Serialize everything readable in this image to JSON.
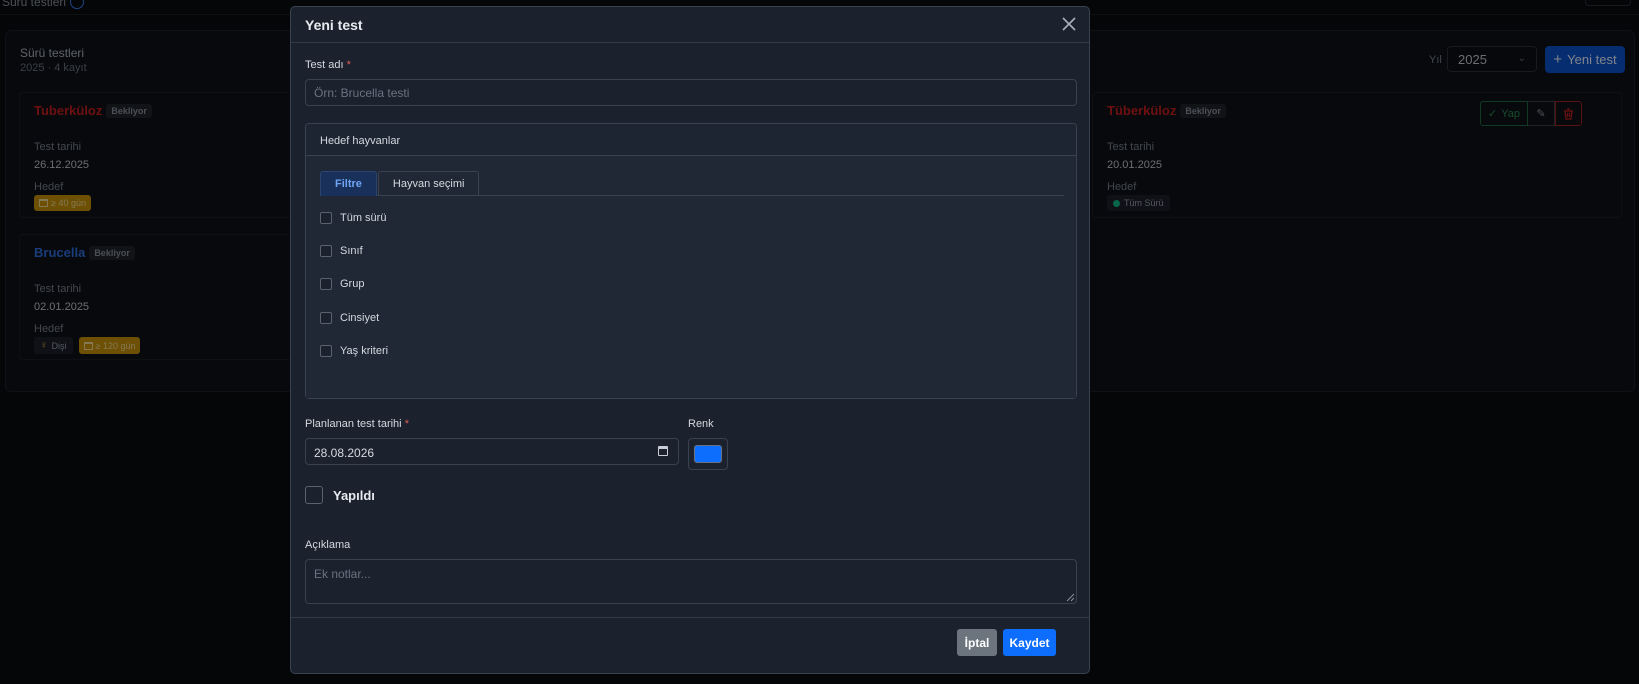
{
  "topbar": {
    "crumb": "Sürü testleri"
  },
  "panel": {
    "title": "Sürü testleri",
    "subtitle": "2025 · 4 kayıt",
    "year_label": "Yıl",
    "year_value": "2025",
    "new_button": "Yeni test"
  },
  "cards": [
    {
      "name": "Tuberküloz",
      "name_color": "#c81e1e",
      "status": "Bekliyor",
      "date_label": "Test tarihi",
      "date": "26.12.2025",
      "target_label": "Hedef",
      "tags": [
        "≥ 40 gün"
      ]
    },
    {
      "name": "Brucella",
      "name_color": "#2f6fe0",
      "status": "Bekliyor",
      "date_label": "Test tarihi",
      "date": "02.01.2025",
      "target_label": "Hedef",
      "tags": [
        "Dişi",
        "≥ 120 gün"
      ]
    },
    {
      "name": "Tüberküloz",
      "name_color": "#c81e1e",
      "status": "Bekliyor",
      "date_label": "Test tarihi",
      "date": "20.01.2025",
      "target_label": "Hedef",
      "tags": [
        "Tüm Sürü"
      ],
      "actions": {
        "yap": "Yap"
      }
    }
  ],
  "modal": {
    "title": "Yeni test",
    "test_name_label": "Test adı",
    "test_name_placeholder": "Örn: Brucella testi",
    "target_title": "Hedef hayvanlar",
    "tabs": [
      "Filtre",
      "Hayvan seçimi"
    ],
    "filters": [
      "Tüm sürü",
      "Sınıf",
      "Grup",
      "Cinsiyet",
      "Yaş kriteri"
    ],
    "planned_date_label": "Planlanan test tarihi",
    "planned_date_value": "28.08.2026",
    "color_label": "Renk",
    "color_value": "#0d6efd",
    "done_label": "Yapıldı",
    "desc_label": "Açıklama",
    "desc_placeholder": "Ek notlar...",
    "cancel": "İptal",
    "save": "Kaydet",
    "required_mark": "*"
  }
}
